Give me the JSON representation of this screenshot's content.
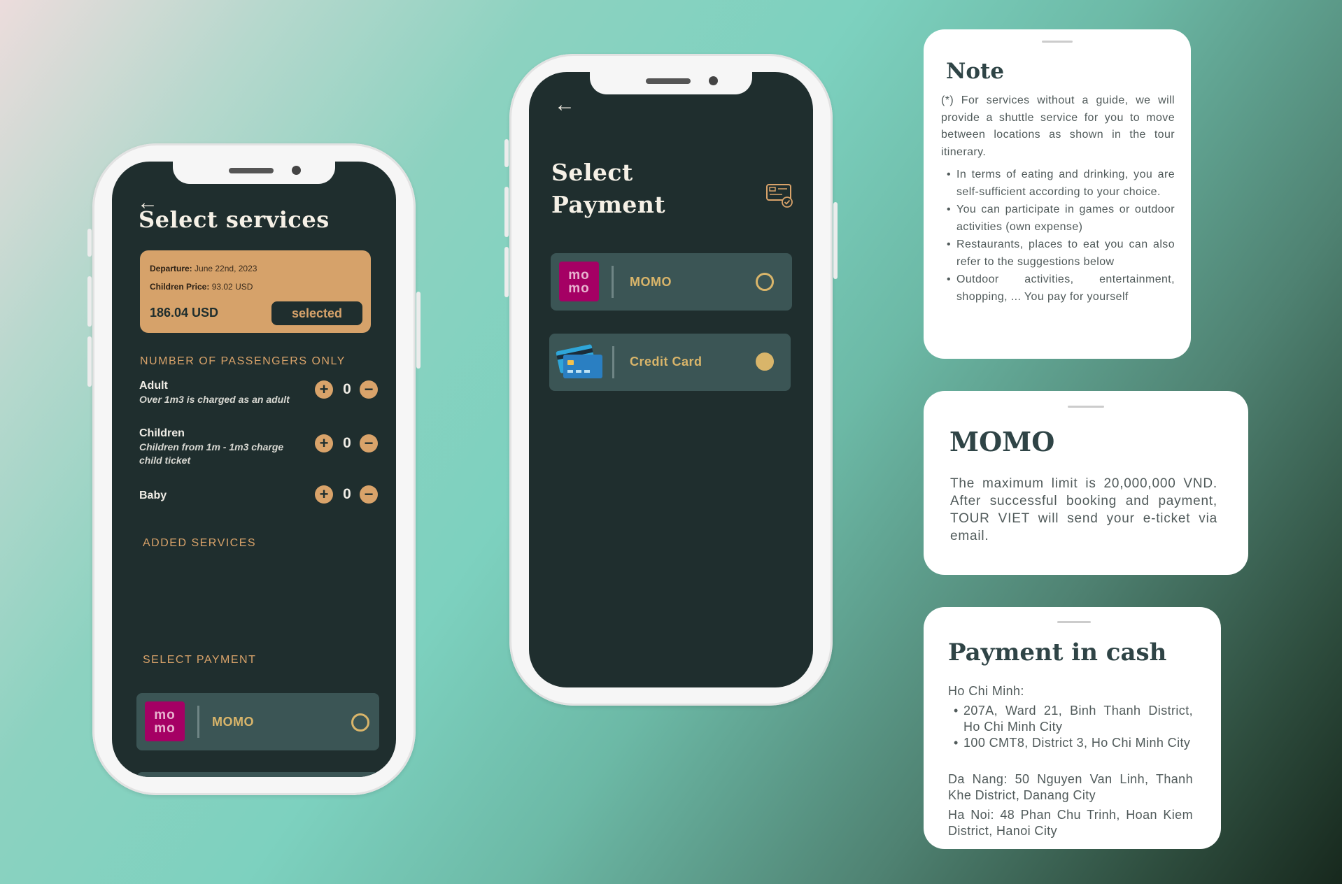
{
  "phone1": {
    "back_icon": "arrow-left-icon",
    "title": "Select services",
    "ticket": {
      "departure_label": "Departure:",
      "departure_value": "June 22nd, 2023",
      "children_price_label": "Children Price:",
      "children_price_value": "93.02 USD",
      "total": "186.04 USD",
      "selected_label": "selected"
    },
    "passengers_heading": "NUMBER OF PASSENGERS ONLY",
    "passengers": [
      {
        "name": "Adult",
        "desc": "Over 1m3 is charged as an adult",
        "count": "0"
      },
      {
        "name": "Children",
        "desc": "Children from 1m - 1m3 charge child ticket",
        "count": "0"
      },
      {
        "name": "Baby",
        "desc": "",
        "count": "0"
      }
    ],
    "stepper_plus": "+",
    "stepper_minus": "−",
    "added_services_heading": "ADDED SERVICES",
    "select_payment_heading": "SELECT PAYMENT",
    "payment_option": {
      "logo_top": "mo",
      "logo_bottom": "mo",
      "label": "MOMO"
    }
  },
  "phone2": {
    "back_icon": "arrow-left-icon",
    "title_line1": "Select",
    "title_line2": "Payment",
    "card_icon": "credit-card-check-icon",
    "options": [
      {
        "logo_top": "mo",
        "logo_bottom": "mo",
        "label": "MOMO",
        "selected": false
      },
      {
        "logo": "credit-cards-icon",
        "label": "Credit Card",
        "selected": true
      }
    ]
  },
  "note_sheet": {
    "title": "Note",
    "intro": "(*) For services without a guide, we will provide a shuttle service for you to move between locations as shown in the tour itinerary.",
    "bullets": [
      "In terms of eating and drinking, you are self-sufficient according to your choice.",
      "You can participate in games or outdoor activities (own expense)",
      "Restaurants, places to eat you can also refer to the suggestions below",
      "Outdoor activities, entertainment, shopping, ... You pay for yourself"
    ]
  },
  "momo_sheet": {
    "title": "MOMO",
    "body": "The maximum limit is 20,000,000 VND. After successful booking and payment, TOUR VIET will send your e-ticket via email."
  },
  "cash_sheet": {
    "title": "Payment in cash",
    "hcm_label": "Ho Chi Minh:",
    "hcm_addresses": [
      "207A, Ward 21, Binh Thanh District, Ho Chi Minh City",
      "100 CMT8, District 3, Ho Chi Minh City"
    ],
    "danang": "Da Nang: 50 Nguyen Van Linh, Thanh Khe District, Danang City",
    "hanoi": "Ha Noi: 48 Phan Chu Trinh, Hoan Kiem District, Hanoi City"
  }
}
